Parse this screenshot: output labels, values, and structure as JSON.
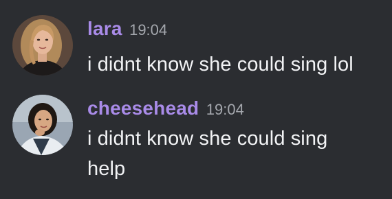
{
  "messages": [
    {
      "username": "lara",
      "timestamp": "19:04",
      "text": "i didnt know she could sing lol",
      "avatar": "avatar-woman-blonde",
      "username_color": "#a98be8"
    },
    {
      "username": "cheesehead",
      "timestamp": "19:04",
      "text": "i didnt know she could sing help",
      "avatar": "avatar-woman-dark-hair",
      "username_color": "#a98be8"
    }
  ],
  "colors": {
    "background": "#2b2d31",
    "text": "#f2f3f5",
    "timestamp": "#a4a7ad"
  }
}
